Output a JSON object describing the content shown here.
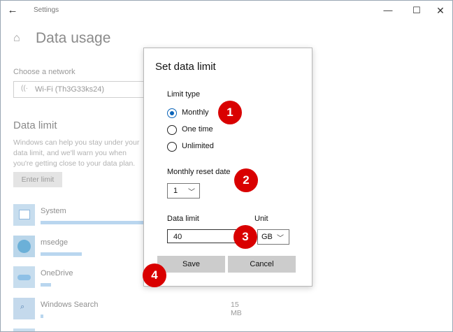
{
  "window": {
    "title": "Settings",
    "back_glyph": "←",
    "minimize_glyph": "—",
    "maximize_glyph": "☐",
    "close_glyph": "✕"
  },
  "page": {
    "home_icon": "home-icon",
    "title": "Data usage",
    "network_label": "Choose a network",
    "network_value": "Wi-Fi (Th3G33ks24)",
    "data_limit_title": "Data limit",
    "description": "Windows can help you stay under your data limit, and we'll warn you when you're getting close to your data plan.",
    "enter_limit_label": "Enter limit"
  },
  "apps": [
    {
      "name": "System",
      "usage_fraction": 1.0,
      "value": "",
      "icon": "system-app-icon"
    },
    {
      "name": "msedge",
      "usage_fraction": 0.4,
      "value": "",
      "icon": "edge-app-icon"
    },
    {
      "name": "OneDrive",
      "usage_fraction": 0.1,
      "value": "",
      "icon": "onedrive-app-icon"
    },
    {
      "name": "Windows Search",
      "usage_fraction": 0.03,
      "value": "15 MB",
      "icon": "search-app-icon"
    }
  ],
  "dialog": {
    "title": "Set data limit",
    "limit_type_label": "Limit type",
    "options": [
      "Monthly",
      "One time",
      "Unlimited"
    ],
    "selected_option": "Monthly",
    "reset_date_label": "Monthly reset date",
    "reset_date_value": "1",
    "data_limit_label": "Data limit",
    "data_limit_value": "40",
    "unit_label": "Unit",
    "unit_value": "GB",
    "save_label": "Save",
    "cancel_label": "Cancel"
  },
  "callouts": [
    "1",
    "2",
    "3",
    "4"
  ],
  "colors": {
    "callout": "#d90000",
    "accent": "#0a63b8"
  }
}
